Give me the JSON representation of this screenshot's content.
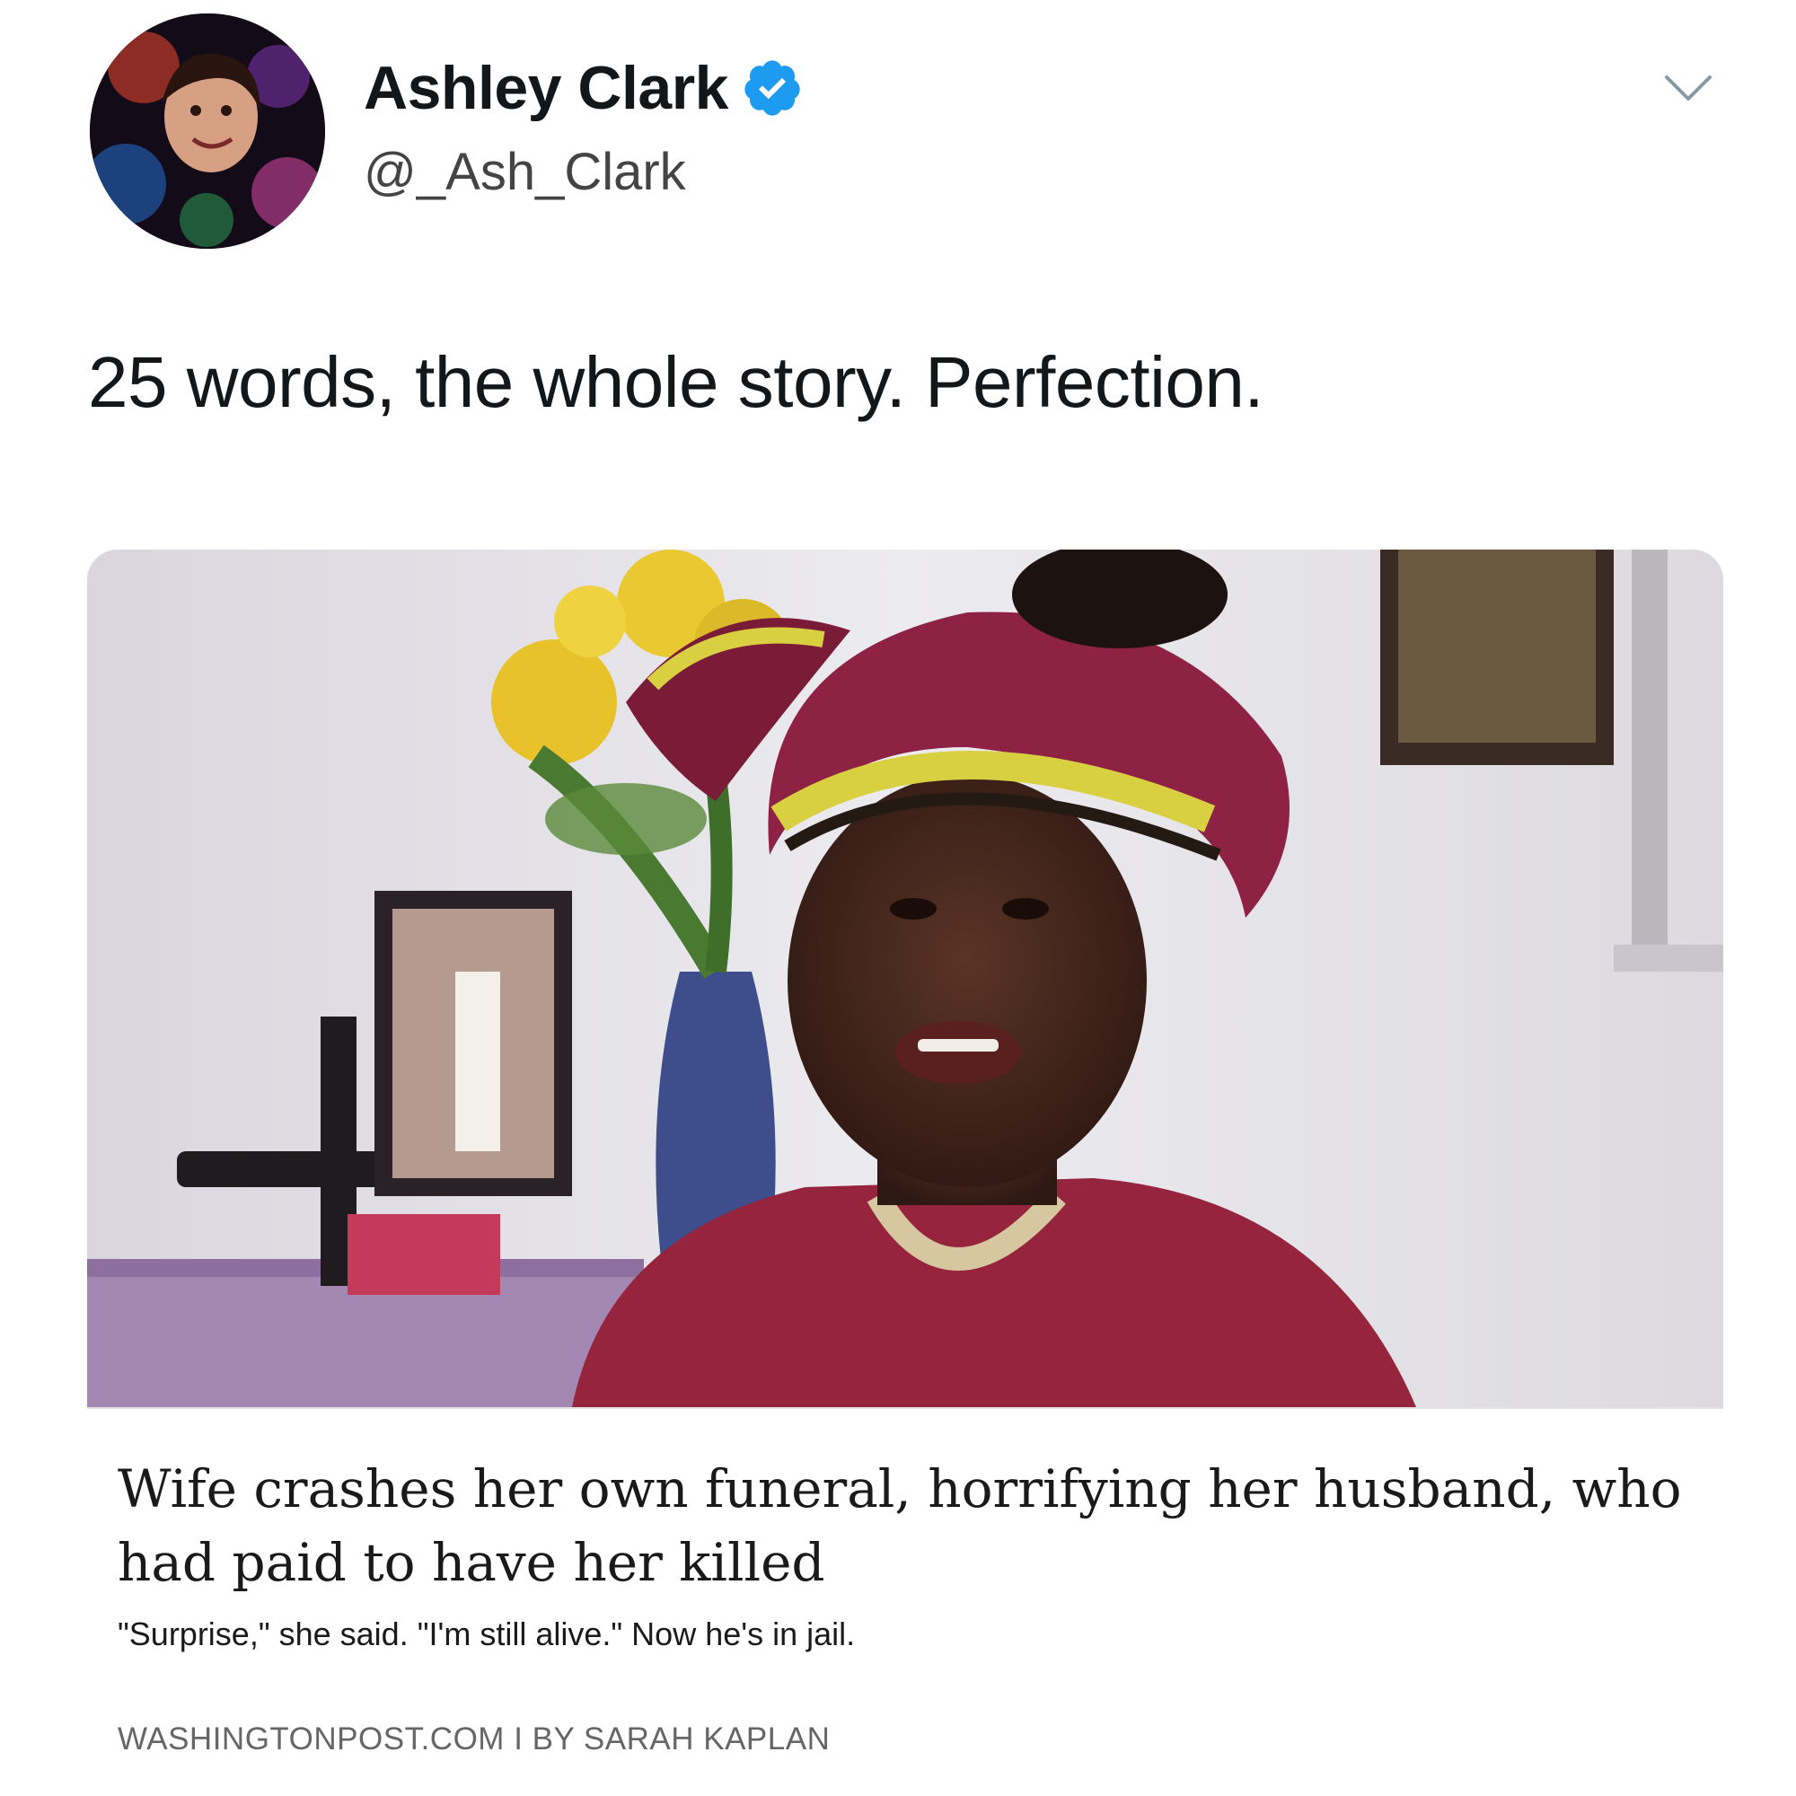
{
  "tweet": {
    "author": {
      "display_name": "Ashley Clark",
      "handle": "@_Ash_Clark",
      "verified": true,
      "avatar_icon": "profile-photo"
    },
    "text": "25 words, the whole story. Perfection.",
    "menu_icon": "chevron-down-icon"
  },
  "link_card": {
    "image_icon": "news-photo",
    "headline": "Wife crashes her own funeral, horrifying her husband, who had paid to have her killed",
    "summary": "\"Surprise,\" she said. \"I'm still alive.\" Now he's in jail.",
    "source": "WASHINGTONPOST.COM I BY SARAH KAPLAN"
  },
  "colors": {
    "verified_badge": "#1d9bf0",
    "text_primary": "#14171a",
    "text_secondary": "#444444",
    "source_text": "#666666"
  }
}
